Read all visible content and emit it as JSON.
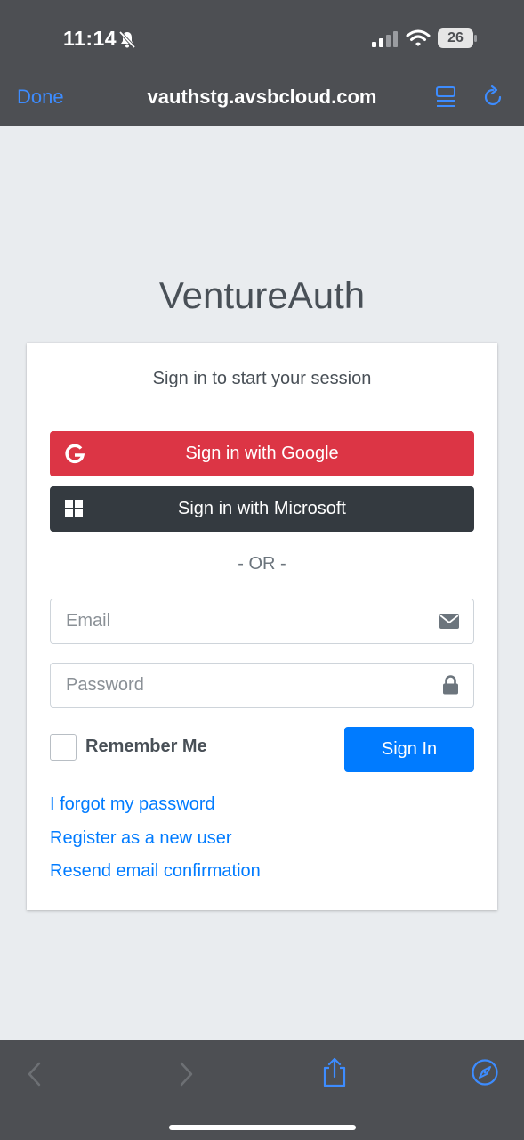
{
  "status_bar": {
    "time": "11:14",
    "battery": "26"
  },
  "browser": {
    "done_label": "Done",
    "url": "vauthstg.avsbcloud.com"
  },
  "page": {
    "logo": "VentureAuth",
    "message": "Sign in to start your session",
    "google_label": "Sign in with Google",
    "microsoft_label": "Sign in with Microsoft",
    "separator": "- OR -",
    "email_placeholder": "Email",
    "password_placeholder": "Password",
    "remember_label": "Remember Me",
    "signin_label": "Sign In",
    "links": {
      "forgot": "I forgot my password",
      "register": "Register as a new user",
      "resend": "Resend email confirmation"
    }
  },
  "colors": {
    "google": "#dc3545",
    "microsoft": "#343a40",
    "primary": "#007bff",
    "browser_accent": "#3d8cff"
  }
}
